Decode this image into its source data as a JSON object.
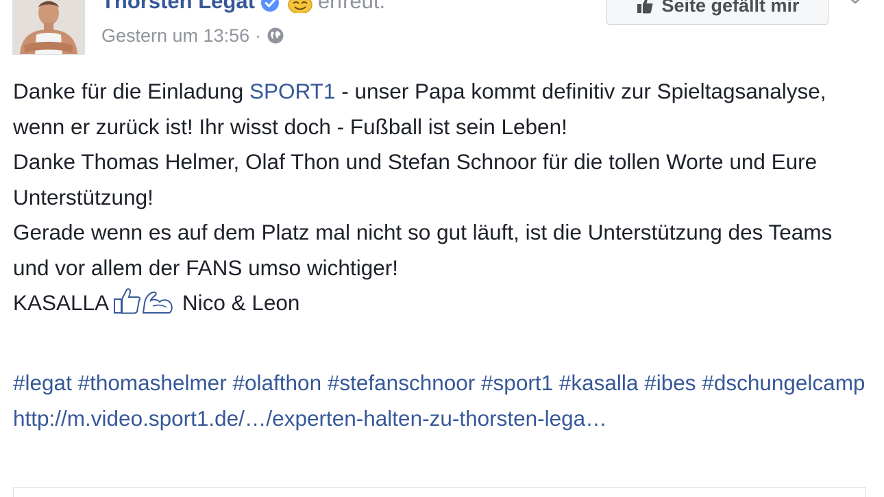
{
  "post": {
    "author": "Thorsten Legat",
    "feeling": "erfreut.",
    "timestamp": "Gestern um 13:56",
    "separator": "·",
    "like_page_button": "Seite gefällt mir",
    "paragraphs": {
      "p1_a": "Danke für die Einladung ",
      "p1_link": "SPORT1",
      "p1_b": " - unser Papa kommt definitiv zur Spieltagsanalyse, wenn er zurück ist! Ihr wisst doch - Fußball ist sein Leben!",
      "p2": "Danke Thomas Helmer, Olaf Thon und Stefan Schnoor für die tollen Worte und Eure Unterstützung!",
      "p3": "Gerade wenn es auf dem Platz mal nicht so gut läuft, ist die Unterstützung des Teams und vor allem der FANS umso wichtiger!",
      "p4_a": "KASALLA",
      "p4_b": " Nico & Leon"
    },
    "hashtags": [
      "#legat",
      "#thomashelmer",
      "#olafthon",
      "#stefanschnoor",
      "#sport1",
      "#kasalla",
      "#ibes",
      "#dschungelcamp"
    ],
    "url": "http://m.video.sport1.de/…/experten-halten-zu-thorsten-lega…"
  },
  "icons": {
    "verified": "verified-badge-icon",
    "feeling": "smiling-face-icon",
    "audience": "globe-icon",
    "like": "thumbs-up-icon",
    "flex": "flexed-biceps-icon",
    "menu": "chevron-down-icon"
  },
  "colors": {
    "link": "#365899",
    "text": "#1d2129",
    "meta": "#90949c",
    "verified": "#5890ff",
    "border": "#dddfe2"
  }
}
